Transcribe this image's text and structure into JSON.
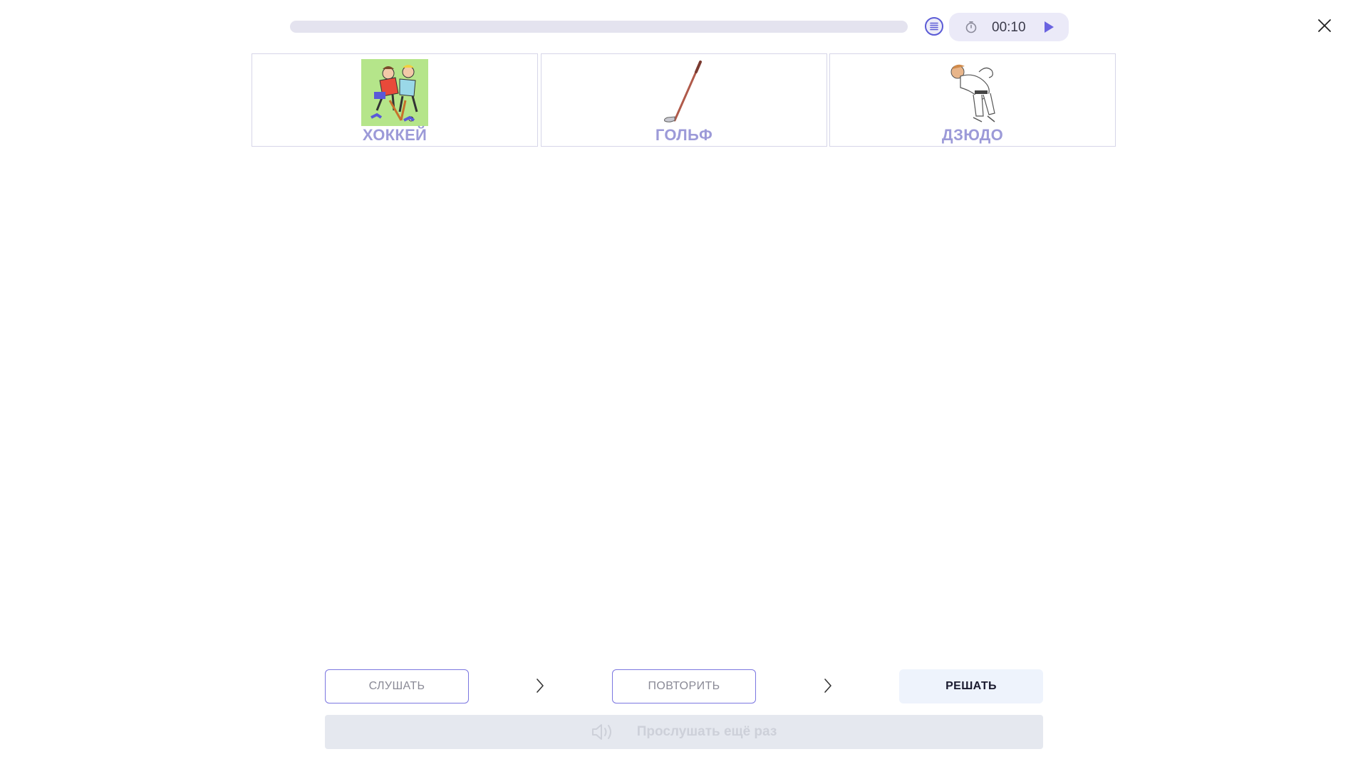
{
  "header": {
    "progress_fraction": 0,
    "timer": "00:10"
  },
  "cards": [
    {
      "label": "ХОККЕЙ"
    },
    {
      "label": "ГОЛЬФ"
    },
    {
      "label": "ДЗЮДО"
    }
  ],
  "steps": {
    "listen": "СЛУШАТЬ",
    "repeat": "ПОВТОРИТЬ",
    "solve": "РЕШАТЬ"
  },
  "listen_again": "Прослушать ещё раз",
  "colors": {
    "accent": "#5b5bd6",
    "label": "#9c9ad8",
    "solve_bg": "#eef3fc"
  }
}
